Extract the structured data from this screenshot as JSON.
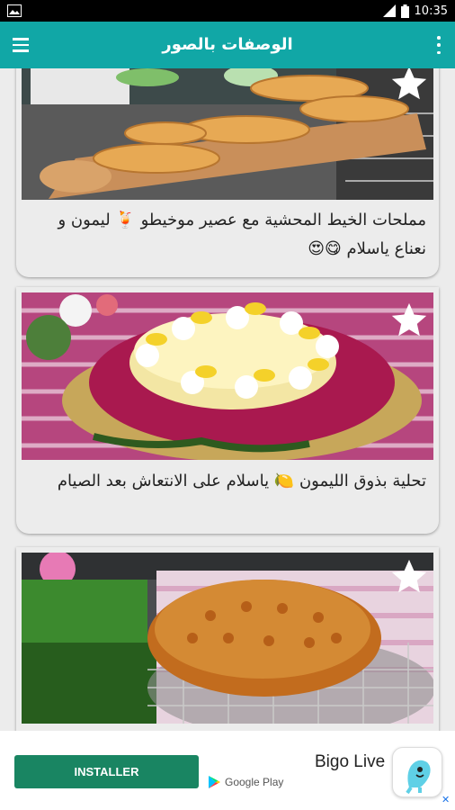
{
  "status_bar": {
    "time": "10:35"
  },
  "app_bar": {
    "title": "الوصفات بالصور"
  },
  "cards": [
    {
      "caption": "مملحات الخيط المحشية مع عصير موخيطو 🍹 ليمون و نعناع ياسلام 😋😍"
    },
    {
      "caption": "تحلية بذوق الليمون 🍋 ياسلام على الانتعاش بعد الصيام"
    },
    {
      "caption": ""
    }
  ],
  "ad": {
    "install_label": "INSTALLER",
    "store_label": "Google Play",
    "brand": "Bigo Live"
  }
}
